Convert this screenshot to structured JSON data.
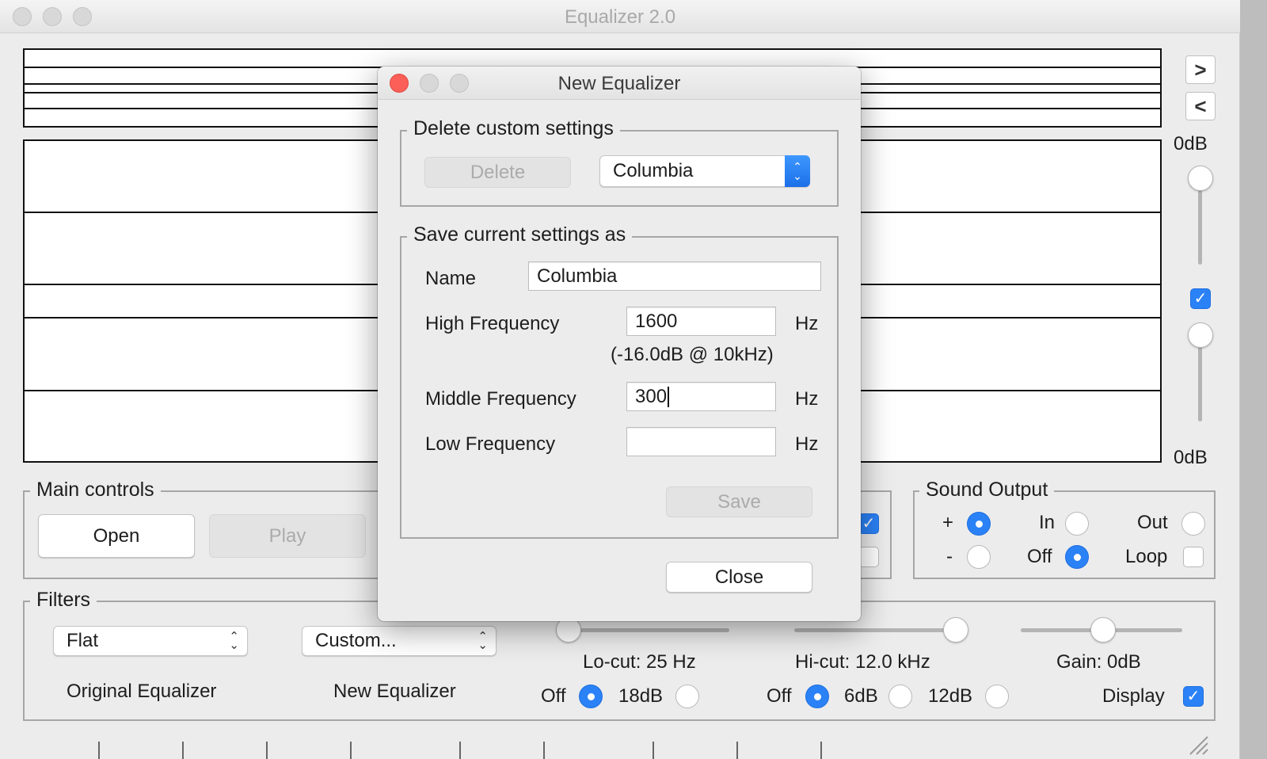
{
  "window": {
    "title": "Equalizer 2.0"
  },
  "right_panel": {
    "next_label": ">",
    "prev_label": "<",
    "top_db": "0dB",
    "bottom_db": "0dB"
  },
  "main_controls": {
    "legend": "Main controls",
    "open_label": "Open",
    "play_label": "Play"
  },
  "sound_output": {
    "legend": "Sound Output",
    "plus_label": "+",
    "minus_label": "-",
    "in_label": "In",
    "off_label": "Off",
    "out_label": "Out",
    "loop_label": "Loop"
  },
  "filters": {
    "legend": "Filters",
    "original_select_value": "Flat",
    "new_select_value": "Custom...",
    "original_label": "Original Equalizer",
    "new_label": "New Equalizer",
    "locut_label": "Lo-cut: 25 Hz",
    "hicut_label": "Hi-cut: 12.0 kHz",
    "gain_label": "Gain: 0dB",
    "locut_off": "Off",
    "locut_18db": "18dB",
    "hicut_off": "Off",
    "hicut_6db": "6dB",
    "hicut_12db": "12dB",
    "display_label": "Display"
  },
  "dialog": {
    "title": "New Equalizer",
    "delete_section": {
      "legend": "Delete custom settings",
      "delete_label": "Delete",
      "selected": "Columbia"
    },
    "save_section": {
      "legend": "Save current settings as",
      "name_label": "Name",
      "name_value": "Columbia",
      "high_label": "High Frequency",
      "high_value": "1600",
      "high_unit": "Hz",
      "high_note": "(-16.0dB @ 10kHz)",
      "middle_label": "Middle Frequency",
      "middle_value": "300",
      "middle_unit": "Hz",
      "low_label": "Low Frequency",
      "low_value": "",
      "low_unit": "Hz",
      "save_label": "Save"
    },
    "close_label": "Close"
  }
}
